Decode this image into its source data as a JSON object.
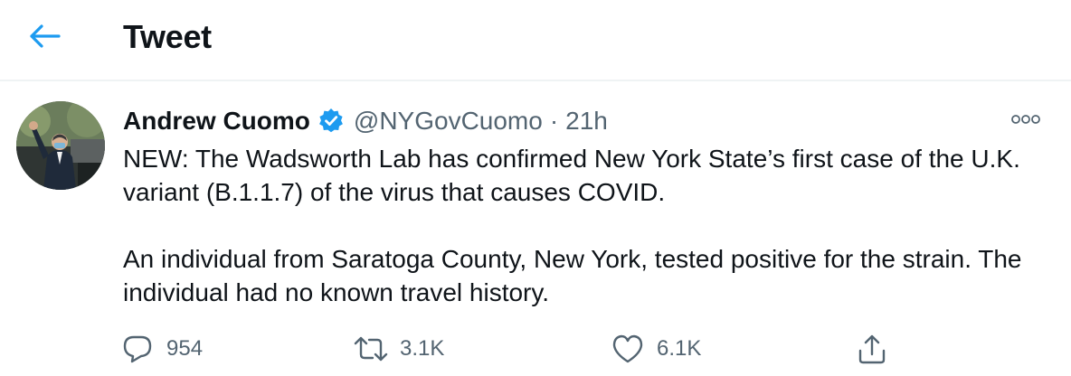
{
  "header": {
    "title": "Tweet",
    "back_icon": "arrow-left-icon",
    "accent_color": "#1d9bf0"
  },
  "tweet": {
    "author": {
      "display_name": "Andrew Cuomo",
      "handle": "@NYGovCuomo",
      "verified": true,
      "verified_color": "#1d9bf0"
    },
    "separator": "·",
    "time": "21h",
    "more_icon": "more-horizontal-icon",
    "text": {
      "paragraph_1": "NEW: The Wadsworth Lab has confirmed New York State’s first case of the U.K. variant (B.1.1.7) of the virus that causes COVID.",
      "paragraph_2": "An individual from Saratoga County, New York, tested positive for the strain. The individual had no known travel history."
    },
    "actions": {
      "reply_count": "954",
      "retweet_count": "3.1K",
      "like_count": "6.1K",
      "reply_icon": "reply-icon",
      "retweet_icon": "retweet-icon",
      "like_icon": "heart-icon",
      "share_icon": "share-icon"
    }
  }
}
